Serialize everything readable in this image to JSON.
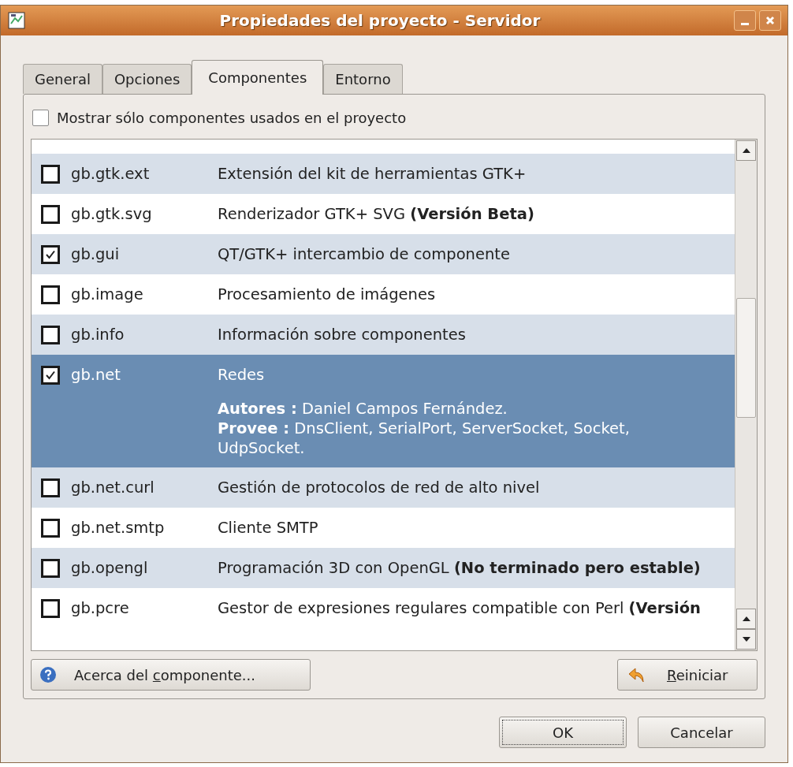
{
  "window": {
    "title": "Propiedades del proyecto - Servidor"
  },
  "tabs": [
    {
      "label": "General",
      "selected": false
    },
    {
      "label": "Opciones",
      "selected": false
    },
    {
      "label": "Componentes",
      "selected": true
    },
    {
      "label": "Entorno",
      "selected": false
    }
  ],
  "filter": {
    "label": "Mostrar sólo componentes usados en el proyecto",
    "checked": false
  },
  "components": [
    {
      "name": "gb.gtk.ext",
      "description": "Extensión del kit de herramientas GTK+",
      "checked": false,
      "selected": false
    },
    {
      "name": "gb.gtk.svg",
      "description": "Renderizador GTK+ SVG **(Versión Beta)**",
      "checked": false,
      "selected": false
    },
    {
      "name": "gb.gui",
      "description": "QT/GTK+ intercambio de componente",
      "checked": true,
      "selected": false
    },
    {
      "name": "gb.image",
      "description": "Procesamiento de imágenes",
      "checked": false,
      "selected": false
    },
    {
      "name": "gb.info",
      "description": "Información sobre componentes",
      "checked": false,
      "selected": false
    },
    {
      "name": "gb.net",
      "description": "Redes",
      "checked": true,
      "selected": true,
      "details": [
        "**Autores :** Daniel Campos Fernández.",
        "**Provee :** DnsClient, SerialPort, ServerSocket, Socket, UdpSocket."
      ]
    },
    {
      "name": "gb.net.curl",
      "description": "Gestión de protocolos de red de alto nivel",
      "checked": false,
      "selected": false
    },
    {
      "name": "gb.net.smtp",
      "description": "Cliente SMTP",
      "checked": false,
      "selected": false
    },
    {
      "name": "gb.opengl",
      "description": "Programación 3D con OpenGL **(No terminado pero estable)**",
      "checked": false,
      "selected": false
    },
    {
      "name": "gb.pcre",
      "description": "Gestor de expresiones regulares compatible con Perl **(Versión**",
      "checked": false,
      "selected": false
    }
  ],
  "about_button": {
    "label_before": "Acerca del ",
    "mnemonic": "c",
    "label_after": "omponente..."
  },
  "reset_button": {
    "mnemonic": "R",
    "label_after": "einiciar"
  },
  "buttons": [
    {
      "label": "OK",
      "kind": "default"
    },
    {
      "label": "Cancelar",
      "kind": "normal"
    }
  ]
}
